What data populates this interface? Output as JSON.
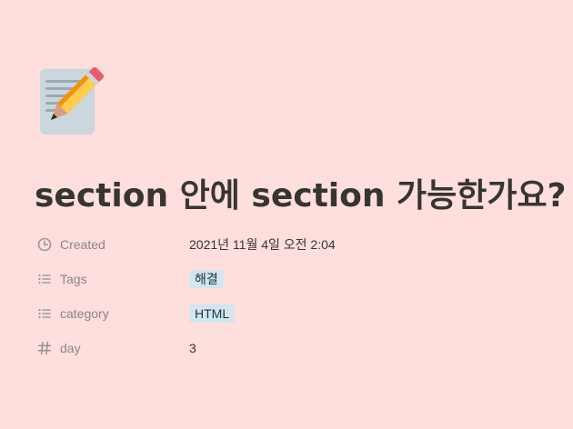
{
  "page": {
    "icon": "memo-pencil-icon",
    "title": "section 안에 section 가능한가요?"
  },
  "properties": [
    {
      "icon": "clock-icon",
      "label": "Created",
      "value": "2021년 11월 4일 오전 2:04"
    },
    {
      "icon": "list-icon",
      "label": "Tags",
      "tag": "해결"
    },
    {
      "icon": "list-icon",
      "label": "category",
      "tag": "HTML"
    },
    {
      "icon": "hash-icon",
      "label": "day",
      "value": "3"
    }
  ],
  "colors": {
    "background": "#ffdede",
    "tag_background": "#d3e5ef",
    "text": "#37352f",
    "muted": "#8a8684"
  }
}
